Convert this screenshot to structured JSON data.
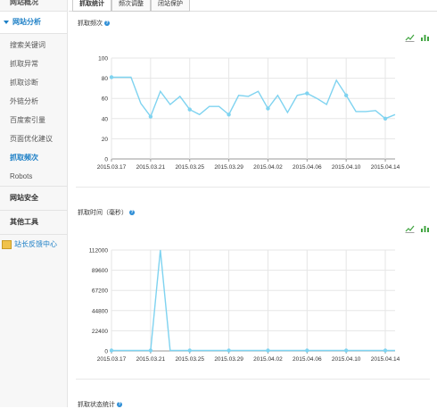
{
  "sidebar": {
    "top_label": "网站概况",
    "active_section": "网站分析",
    "items": [
      {
        "label": "搜索关键词"
      },
      {
        "label": "抓取异常"
      },
      {
        "label": "抓取诊断"
      },
      {
        "label": "外链分析"
      },
      {
        "label": "百度索引量"
      },
      {
        "label": "页面优化建议"
      },
      {
        "label": "抓取频次",
        "current": true
      },
      {
        "label": "Robots"
      }
    ],
    "sections": [
      "网站安全",
      "其他工具"
    ],
    "feedback": "站长反馈中心"
  },
  "tabs": [
    {
      "label": "抓取统计",
      "active": true
    },
    {
      "label": "频次调整",
      "active": false
    },
    {
      "label": "闭站保护",
      "active": false
    }
  ],
  "help_icon": "?",
  "colors": {
    "accent": "#1c7fc6",
    "series": "#7fd3f0",
    "icon": "#3fa43f"
  },
  "sections": {
    "crawl_freq_title": "抓取频次",
    "crawl_time_title": "抓取时间（毫秒）",
    "crawl_status_title": "抓取状态统计"
  },
  "chart_data": [
    {
      "type": "line",
      "x": [
        "2015.03.17",
        "2015.03.18",
        "2015.03.19",
        "2015.03.20",
        "2015.03.21",
        "2015.03.22",
        "2015.03.23",
        "2015.03.24",
        "2015.03.25",
        "2015.03.26",
        "2015.03.27",
        "2015.03.28",
        "2015.03.29",
        "2015.03.30",
        "2015.03.31",
        "2015.04.01",
        "2015.04.02",
        "2015.04.03",
        "2015.04.04",
        "2015.04.05",
        "2015.04.06",
        "2015.04.07",
        "2015.04.08",
        "2015.04.09",
        "2015.04.10",
        "2015.04.11",
        "2015.04.12",
        "2015.04.13",
        "2015.04.14",
        "2015.04.15"
      ],
      "xticks": [
        "2015.03.17",
        "2015.03.21",
        "2015.03.25",
        "2015.03.29",
        "2015.04.02",
        "2015.04.06",
        "2015.04.10",
        "2015.04.14"
      ],
      "values": [
        81,
        81,
        81,
        55,
        42,
        67,
        54,
        62,
        49,
        44,
        52,
        52,
        44,
        63,
        62,
        67,
        50,
        63,
        46,
        63,
        65,
        60,
        54,
        78,
        63,
        47,
        47,
        48,
        40,
        44
      ],
      "markers": [
        0,
        4,
        8,
        12,
        16,
        20,
        24,
        28
      ],
      "ylim": [
        0,
        100
      ],
      "yticks": [
        "0",
        "20",
        "40",
        "60",
        "80",
        "100"
      ],
      "grid": true
    },
    {
      "type": "line",
      "x": [
        "2015.03.17",
        "2015.03.18",
        "2015.03.19",
        "2015.03.20",
        "2015.03.21",
        "2015.03.22",
        "2015.03.23",
        "2015.03.24",
        "2015.03.25",
        "2015.03.26",
        "2015.03.27",
        "2015.03.28",
        "2015.03.29",
        "2015.03.30",
        "2015.03.31",
        "2015.04.01",
        "2015.04.02",
        "2015.04.03",
        "2015.04.04",
        "2015.04.05",
        "2015.04.06",
        "2015.04.07",
        "2015.04.08",
        "2015.04.09",
        "2015.04.10",
        "2015.04.11",
        "2015.04.12",
        "2015.04.13",
        "2015.04.14",
        "2015.04.15"
      ],
      "xticks": [
        "2015.03.17",
        "2015.03.21",
        "2015.03.25",
        "2015.03.29",
        "2015.04.02",
        "2015.04.06",
        "2015.04.10",
        "2015.04.14"
      ],
      "values": [
        500,
        500,
        500,
        500,
        500,
        112000,
        500,
        500,
        500,
        500,
        500,
        500,
        500,
        500,
        500,
        500,
        500,
        500,
        500,
        500,
        500,
        500,
        500,
        500,
        500,
        500,
        500,
        500,
        500,
        500
      ],
      "markers": [
        0,
        4,
        8,
        12,
        16,
        20,
        24,
        28
      ],
      "ylim": [
        0,
        112000
      ],
      "yticks": [
        "0",
        "22400",
        "44800",
        "67200",
        "89600",
        "112000"
      ],
      "grid": true
    }
  ]
}
